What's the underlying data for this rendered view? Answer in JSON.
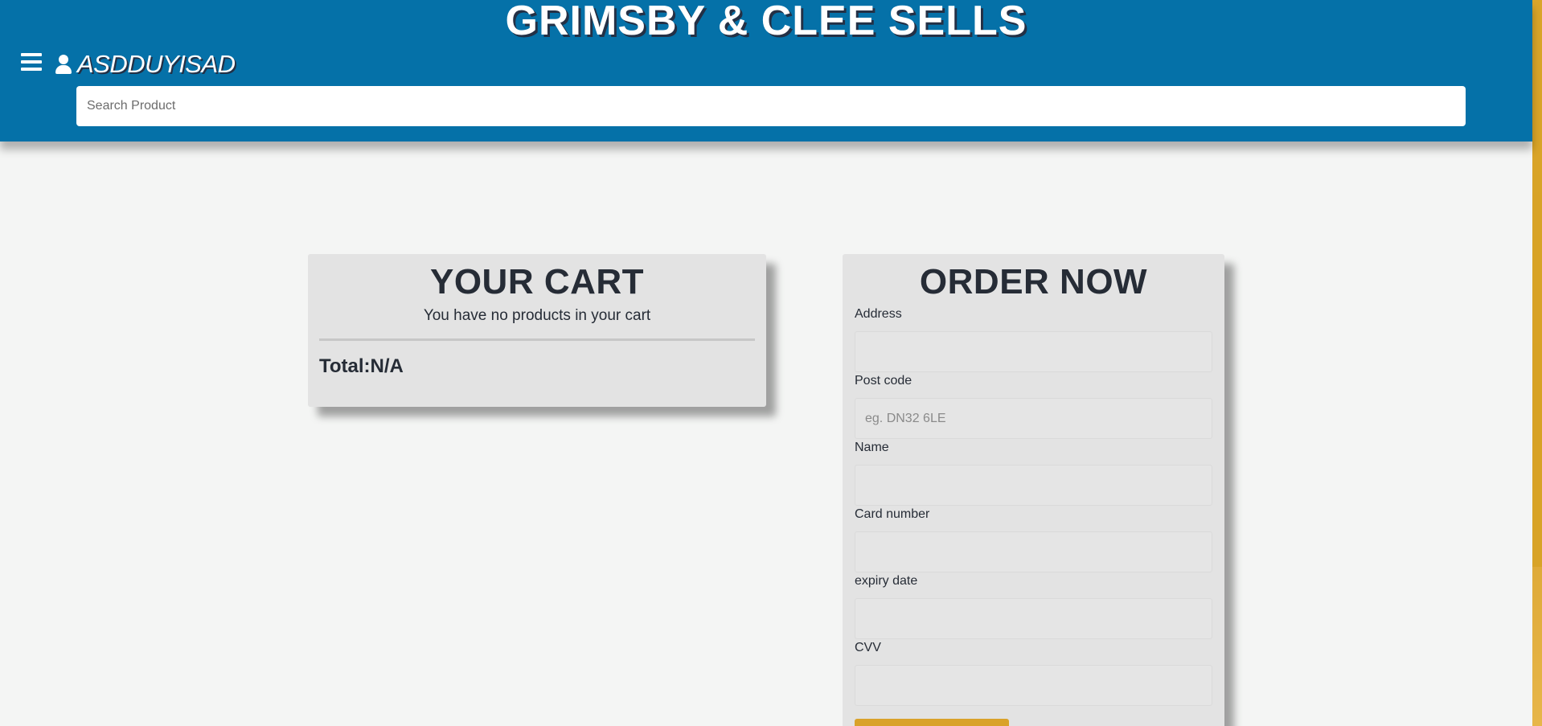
{
  "header": {
    "site_title": "GRIMSBY & CLEE SELLS",
    "username": "ASDDUYISAD",
    "search_placeholder": "Search Product",
    "brand_color": "#0571a8",
    "accent_color": "#d9a22a",
    "menu_icon": "hamburger-icon",
    "user_icon": "user-icon"
  },
  "cart": {
    "title": "YOUR CART",
    "empty_message": "You have no products in your cart",
    "total_text": "Total:N/A"
  },
  "order": {
    "title": "ORDER NOW",
    "fields": [
      {
        "label": "Address",
        "placeholder": ""
      },
      {
        "label": "Post code",
        "placeholder": "eg. DN32 6LE"
      },
      {
        "label": "Name",
        "placeholder": ""
      },
      {
        "label": "Card number",
        "placeholder": ""
      },
      {
        "label": "expiry date",
        "placeholder": ""
      },
      {
        "label": "CVV",
        "placeholder": ""
      }
    ]
  }
}
